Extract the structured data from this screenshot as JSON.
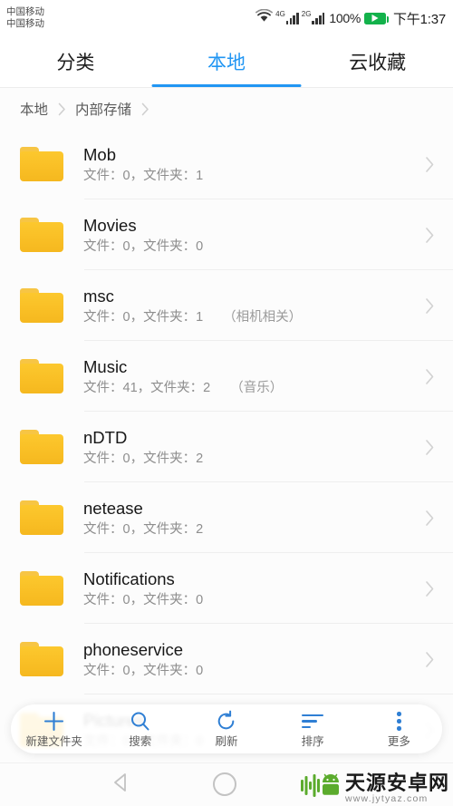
{
  "statusbar": {
    "carrier_line1": "中国移动",
    "carrier_line2": "中国移动",
    "net1_label": "4G",
    "net2_label": "2G",
    "battery_percent": "100%",
    "clock": "下午1:37",
    "battery_color": "#13b24b"
  },
  "tabs": {
    "accent_color": "#2196f3",
    "items": [
      {
        "label": "分类",
        "active": false
      },
      {
        "label": "本地",
        "active": true
      },
      {
        "label": "云收藏",
        "active": false
      }
    ]
  },
  "breadcrumb": {
    "items": [
      {
        "label": "本地"
      },
      {
        "label": "内部存储"
      }
    ]
  },
  "list": {
    "meta_prefix_file": "文件：",
    "meta_prefix_folder": "文件夹：",
    "rows": [
      {
        "name": "Mob",
        "meta": "文件：0，文件夹：1",
        "note": ""
      },
      {
        "name": "Movies",
        "meta": "文件：0，文件夹：0",
        "note": ""
      },
      {
        "name": "msc",
        "meta": "文件：0，文件夹：1",
        "note": "（相机相关）"
      },
      {
        "name": "Music",
        "meta": "文件：41，文件夹：2",
        "note": "（音乐）"
      },
      {
        "name": "nDTD",
        "meta": "文件：0，文件夹：2",
        "note": ""
      },
      {
        "name": "netease",
        "meta": "文件：0，文件夹：2",
        "note": ""
      },
      {
        "name": "Notifications",
        "meta": "文件：0，文件夹：0",
        "note": ""
      },
      {
        "name": "phoneservice",
        "meta": "文件：0，文件夹：0",
        "note": ""
      },
      {
        "name": "Pictures",
        "meta": "文件：0，文件夹：0",
        "note": ""
      }
    ]
  },
  "toolbar": {
    "icon_color": "#2f7fd4",
    "items": [
      {
        "label": "新建文件夹",
        "icon": "plus-icon"
      },
      {
        "label": "搜索",
        "icon": "search-icon"
      },
      {
        "label": "刷新",
        "icon": "refresh-icon"
      },
      {
        "label": "排序",
        "icon": "sort-icon"
      },
      {
        "label": "更多",
        "icon": "more-vertical-icon"
      }
    ]
  },
  "navbar": {
    "back_label": "back-icon",
    "home_label": "home-icon"
  },
  "watermark": {
    "title": "天源安卓网",
    "url": "www.jytyaz.com",
    "color": "#5bab2d"
  }
}
